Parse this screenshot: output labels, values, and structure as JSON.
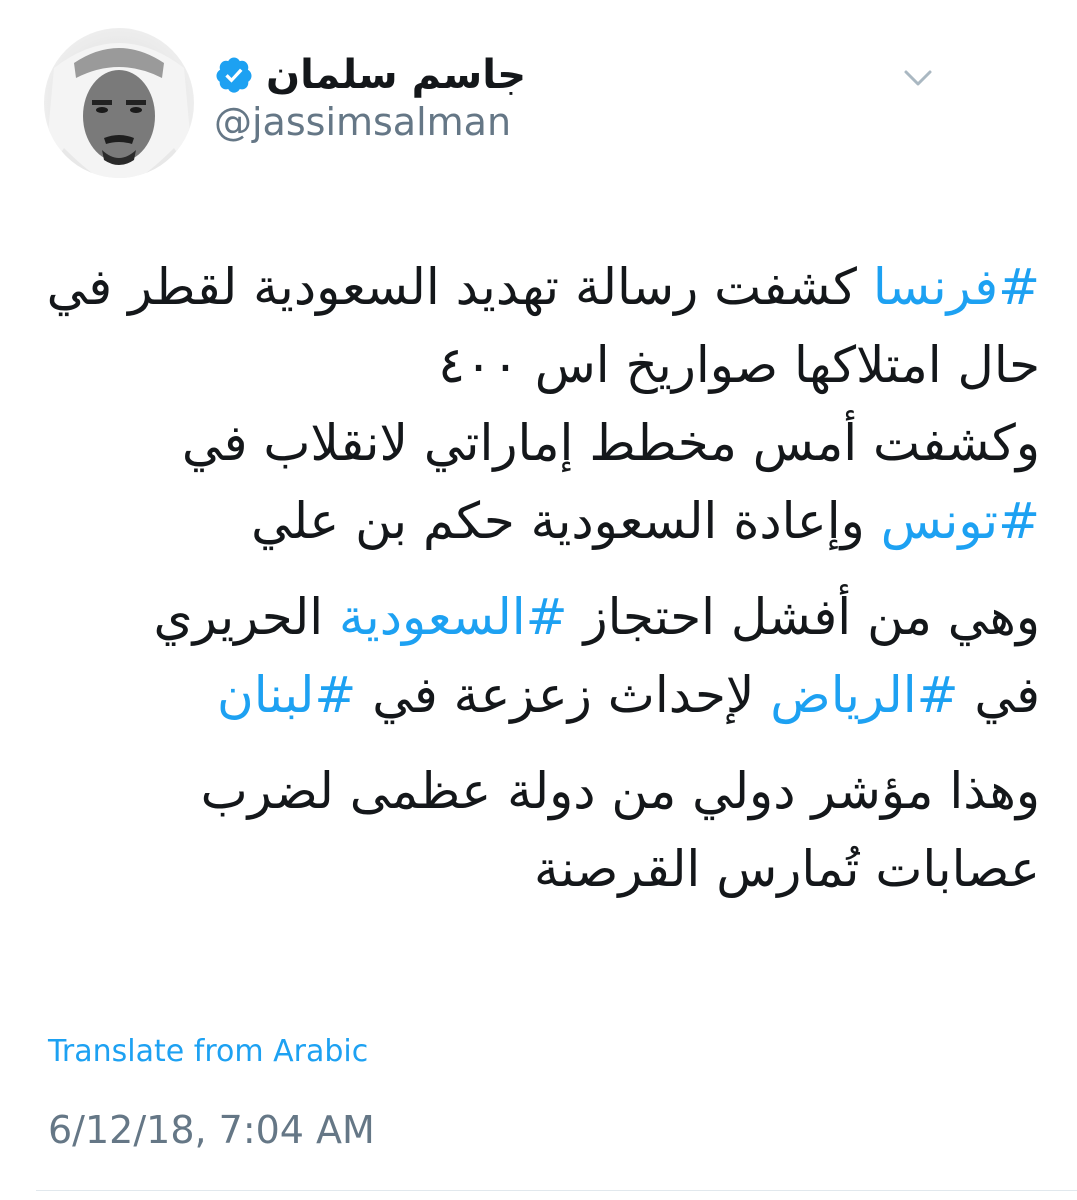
{
  "author": {
    "display_name": "جاسم سلمان",
    "handle": "@jassimsalman",
    "verified": true,
    "avatar_icon": "profile-photo"
  },
  "menu": {
    "icon": "chevron-down-icon"
  },
  "tweet": {
    "p1": {
      "l1_tag": "#فرنسا",
      "l1_text": " كشفت رسالة تهديد السعودية لقطر في",
      "l2_text": "حال امتلاكها صواريخ اس ٤٠٠",
      "l3_text": "وكشفت أمس مخطط إماراتي لانقلاب في",
      "l4_tag": "#تونس",
      "l4_text": " وإعادة السعودية حكم بن علي"
    },
    "p2": {
      "l1_text_a": "وهي من أفشل احتجاز ",
      "l1_tag": "#السعودية",
      "l1_text_b": " الحريري",
      "l2_text_a": "في ",
      "l2_tag_a": "#الرياض",
      "l2_text_b": " لإحداث زعزعة في ",
      "l2_tag_b": "#لبنان"
    },
    "p3": {
      "l1_text": "وهذا مؤشر دولي من دولة عظمى لضرب",
      "l2_text": "عصابات تُمارس القرصنة"
    }
  },
  "translate_label": "Translate from Arabic",
  "timestamp": "6/12/18, 7:04 AM",
  "colors": {
    "link": "#1da1f2",
    "text": "#14171a",
    "secondary": "#657786",
    "verified_badge": "#1da1f2"
  }
}
